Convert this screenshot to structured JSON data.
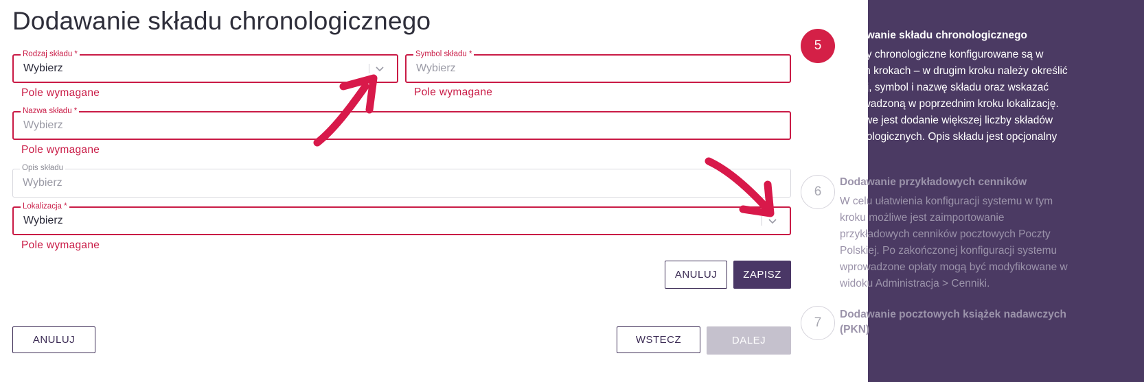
{
  "page": {
    "title": "Dodawanie składu chronologicznego"
  },
  "form": {
    "rodzaj": {
      "label": "Rodzaj składu *",
      "value": "Wybierz",
      "error": "Pole wymagane"
    },
    "symbol": {
      "label": "Symbol składu *",
      "placeholder": "Wybierz",
      "error": "Pole wymagane"
    },
    "nazwa": {
      "label": "Nazwa składu *",
      "placeholder": "Wybierz",
      "error": "Pole wymagane"
    },
    "opis": {
      "label": "Opis składu",
      "placeholder": "Wybierz"
    },
    "lokalizacja": {
      "label": "Lokalizacja *",
      "value": "Wybierz",
      "error": "Pole wymagane"
    },
    "cancel_label": "ANULUJ",
    "save_label": "ZAPISZ"
  },
  "footer": {
    "cancel_label": "ANULUJ",
    "back_label": "WSTECZ",
    "next_label": "DALEJ"
  },
  "sidebar": {
    "steps": [
      {
        "number": "5",
        "title": "Dodawanie składu chronologicznego",
        "description": "Składy chronologiczne konfigurowane są w dwóch krokach – w drugim kroku należy określić rodzaj, symbol i nazwę składu oraz wskazać wprowadzoną w poprzednim kroku lokalizację. Możliwe jest dodanie większej liczby składów chronologicznych. Opis składu jest opcjonalny"
      },
      {
        "number": "6",
        "title": "Dodawanie przykładowych cenników",
        "description": "W celu ułatwienia konfiguracji systemu w tym kroku możliwe jest zaimportowanie przykładowych cenników pocztowych Poczty Polskiej. Po zakończonej konfiguracji systemu wprowadzone opłaty mogą być modyfikowane w widoku Administracja > Cenniki."
      },
      {
        "number": "7",
        "title": "Dodawanie pocztowych książek nadawczych (PKN)"
      }
    ]
  },
  "colors": {
    "accent_error": "#c91a45",
    "primary": "#4a3766",
    "sidebar_bg": "#4b3a63",
    "annotation_arrow": "#d8194a"
  },
  "icons": {
    "dropdown": "chevron-down-icon",
    "annotation": "arrow-icon"
  }
}
